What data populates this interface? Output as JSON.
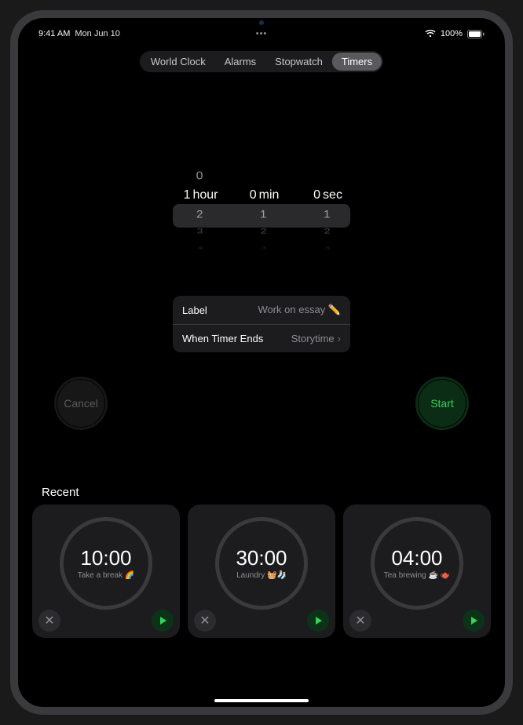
{
  "status": {
    "time": "9:41 AM",
    "date": "Mon Jun 10",
    "battery_pct": "100%"
  },
  "tabs": {
    "items": [
      "World Clock",
      "Alarms",
      "Stopwatch",
      "Timers"
    ],
    "selected_index": 3
  },
  "picker": {
    "hours": {
      "selected": "1",
      "unit": "hour",
      "above": [
        "0"
      ],
      "below": [
        "2",
        "3",
        "4"
      ]
    },
    "minutes": {
      "selected": "0",
      "unit": "min",
      "above": [],
      "below": [
        "1",
        "2",
        "3"
      ]
    },
    "seconds": {
      "selected": "0",
      "unit": "sec",
      "above": [],
      "below": [
        "1",
        "2",
        "3"
      ]
    }
  },
  "settings": {
    "label_key": "Label",
    "label_value": "Work on essay ✏️",
    "ends_key": "When Timer Ends",
    "ends_value": "Storytime"
  },
  "buttons": {
    "cancel": "Cancel",
    "start": "Start"
  },
  "recent": {
    "title": "Recent",
    "items": [
      {
        "time": "10:00",
        "label": "Take a break 🌈"
      },
      {
        "time": "30:00",
        "label": "Laundry 🧺🧦"
      },
      {
        "time": "04:00",
        "label": "Tea brewing ☕️ 🫖"
      }
    ]
  }
}
